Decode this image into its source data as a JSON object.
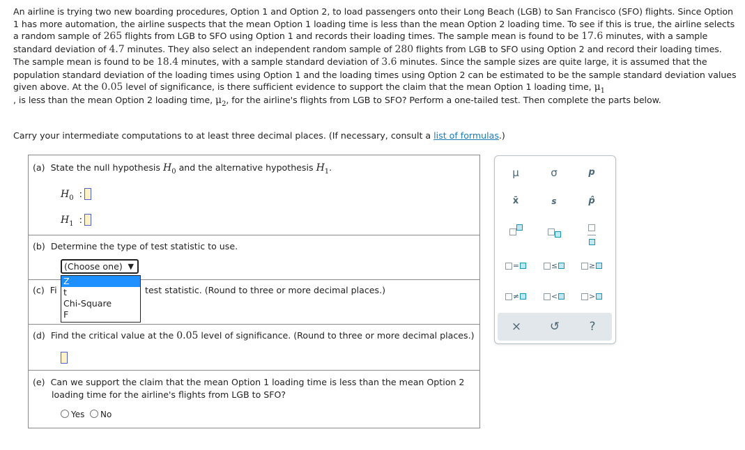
{
  "problem": {
    "segments": [
      "An airline is trying two new boarding procedures, Option 1 and Option 2, to load passengers onto their Long Beach (LGB) to San Francisco (SFO) flights. Since Option 1 has more automation, the airline suspects that the mean Option 1 loading time is less than the mean Option 2 loading time. To see if this is true, the airline selects a random sample of ",
      "265",
      " flights from LGB to SFO using Option 1 and records their loading times. The sample mean is found to be ",
      "17.6",
      " minutes, with a sample standard deviation of ",
      "4.7",
      " minutes. They also select an independent random sample of ",
      "280",
      " flights from LGB to SFO using Option 2 and record their loading times. The sample mean is found to be ",
      "18.4",
      " minutes, with a sample standard deviation of ",
      "3.6",
      " minutes. Since the sample sizes are quite large, it is assumed that the population standard deviation of the loading times using Option 1 and the loading times using Option 2 can be estimated to be the sample standard deviation values given above. At the ",
      "0.05",
      " level of significance, is there sufficient evidence to support the claim that the mean Option 1 loading time, ",
      "μ",
      "1",
      ", is less than the mean Option 2 loading time, ",
      "μ",
      "2",
      ", for the airline's flights from LGB to SFO? Perform a one-tailed test. Then complete the parts below."
    ]
  },
  "instructions": {
    "text_before_link": "Carry your intermediate computations to at least three decimal places. (If necessary, consult a ",
    "link_text": "list of formulas",
    "text_after_link": ".)"
  },
  "parts": {
    "a": {
      "label": "(a)",
      "text": "State the null hypothesis ",
      "h0_symbol": "H",
      "h0_sub": "0",
      "mid_text": " and the alternative hypothesis ",
      "h1_symbol": "H",
      "h1_sub": "1",
      "end_text": ".",
      "h0_answer": "",
      "h1_answer": ""
    },
    "b": {
      "label": "(b)",
      "text": "Determine the type of test statistic to use.",
      "select_value": "(Choose one)",
      "select_arrow": "▼",
      "options": [
        "Z",
        "t",
        "Chi-Square",
        "F"
      ],
      "highlighted_option": "Z"
    },
    "c": {
      "label": "(c)",
      "text_visible_start": "Fi",
      "text_visible_end": "test statistic. (Round to three or more decimal places.)"
    },
    "d": {
      "label": "(d)",
      "text_before": "Find the critical value at the ",
      "alpha": "0.05",
      "text_after": " level of significance. (Round to three or more decimal places.)",
      "answer": ""
    },
    "e": {
      "label": "(e)",
      "line1": "Can we support the claim that the mean Option 1 loading time is less than the mean Option 2",
      "line2": "loading time for the airline's flights from LGB to SFO?",
      "options": [
        "Yes",
        "No"
      ]
    }
  },
  "palette": {
    "symbols": [
      "μ",
      "σ",
      "p",
      "x̄",
      "s",
      "p̂"
    ],
    "relations": [
      "=",
      "≤",
      "≥",
      "≠",
      "<",
      ">"
    ],
    "footer": [
      "×",
      "↺",
      "?"
    ],
    "colors": {
      "accent": "#1595b4",
      "icon": "#4a6777",
      "footer_bg": "#e1e7ea"
    }
  }
}
